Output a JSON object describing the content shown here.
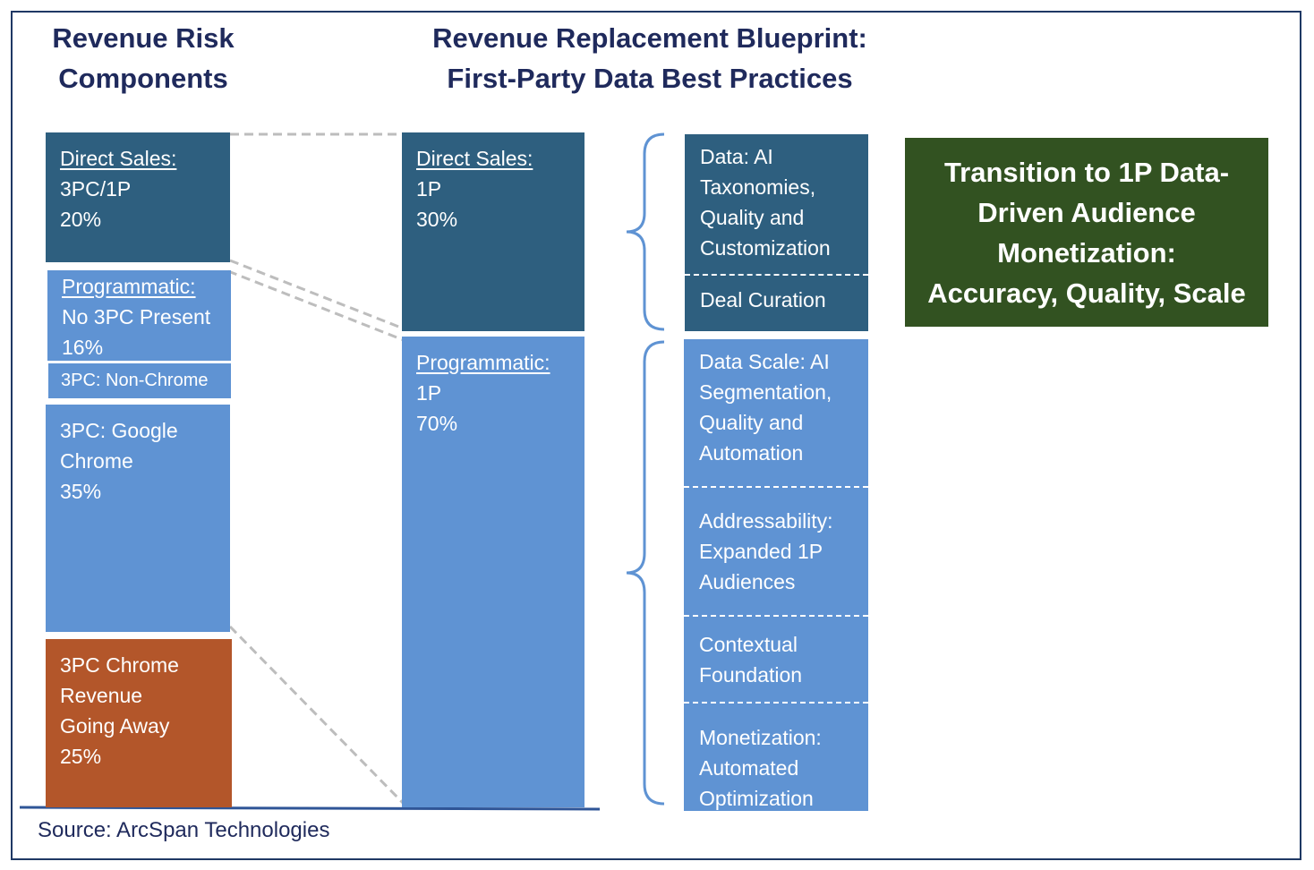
{
  "titles": {
    "left": [
      "Revenue Risk",
      "Components"
    ],
    "center": [
      "Revenue Replacement Blueprint:",
      "First-Party Data Best Practices"
    ]
  },
  "left_column": {
    "direct_sales": {
      "heading": "Direct Sales:",
      "lines": [
        "3PC/1P",
        "20%"
      ]
    },
    "programmatic": {
      "heading": "Programmatic:",
      "lines": [
        "No 3PC Present",
        "16%"
      ]
    },
    "non_chrome": {
      "label": "3PC: Non-Chrome"
    },
    "google_chrome": {
      "lines": [
        "3PC: Google",
        "Chrome",
        "35%"
      ]
    },
    "going_away": {
      "lines": [
        "3PC Chrome",
        "Revenue",
        "Going Away",
        "25%"
      ]
    }
  },
  "center_column": {
    "direct_sales": {
      "heading": "Direct Sales:",
      "lines": [
        "1P",
        "30%"
      ]
    },
    "programmatic": {
      "heading": "Programmatic:",
      "lines": [
        "1P",
        "70%"
      ]
    }
  },
  "right_column": {
    "direct_items": [
      [
        "Data: AI",
        "Taxonomies,",
        "Quality and",
        "Customization"
      ],
      [
        "Deal Curation"
      ]
    ],
    "programmatic_items": [
      [
        "Data Scale: AI",
        "Segmentation,",
        "Quality and",
        "Automation"
      ],
      [
        "Addressability:",
        "Expanded 1P",
        "Audiences"
      ],
      [
        "Contextual",
        "Foundation"
      ],
      [
        "Monetization:",
        "Automated",
        "Optimization"
      ]
    ]
  },
  "callout": [
    "Transition to 1P Data-",
    "Driven Audience",
    "Monetization:",
    "Accuracy, Quality, Scale"
  ],
  "source": "Source: ArcSpan Technologies",
  "colors": {
    "dark_blue": "#2e5f7f",
    "light_blue": "#5f93d3",
    "orange": "#b3562a",
    "green": "#325221",
    "title": "#1f2a5c"
  }
}
